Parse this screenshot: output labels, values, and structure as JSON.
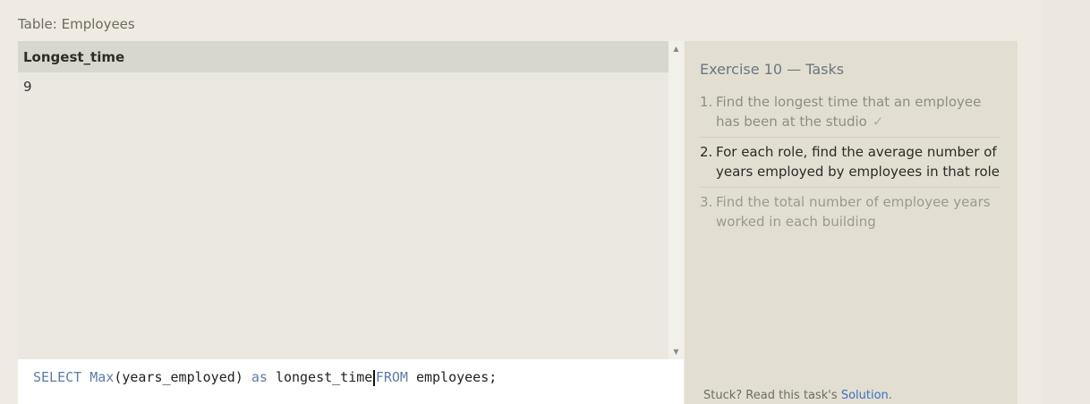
{
  "table_caption": "Table: Employees",
  "results": {
    "column_header": "Longest_time",
    "rows": [
      [
        "9"
      ]
    ]
  },
  "editor": {
    "tokens": {
      "select": "SELECT",
      "max_fn": "Max",
      "arg": "(years_employed)",
      "as": "as",
      "alias": "longest_time",
      "from": "FROM",
      "table": "employees;"
    }
  },
  "tasks": {
    "title": "Exercise 10 — Tasks",
    "items": [
      {
        "num": "1.",
        "text": "Find the longest time that an employee has been at the studio",
        "status": "done",
        "check": "✓"
      },
      {
        "num": "2.",
        "text": "For each role, find the average number of years employed by employees in that role",
        "status": "active"
      },
      {
        "num": "3.",
        "text": "Find the total number of employee years worked in each building",
        "status": "pending"
      }
    ],
    "stuck_text": "Stuck? Read this task's",
    "solution_link": "Solution",
    "stuck_suffix": "."
  },
  "colors": {
    "keyword": "#5c7ba8",
    "link": "#3b6fc0",
    "check": "#9cb59a"
  }
}
